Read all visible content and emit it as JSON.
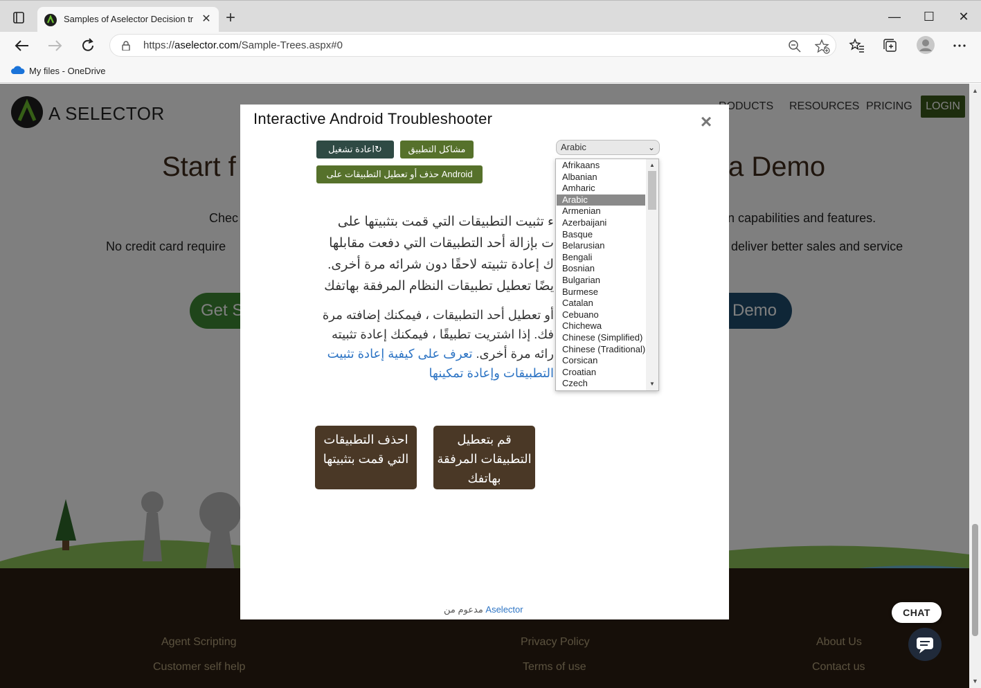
{
  "browser": {
    "tab_title": "Samples of Aselector Decision tr",
    "tab_close": "✕",
    "new_tab": "+",
    "url_prefix": "https://",
    "url_host": "aselector.com",
    "url_path": "/Sample-Trees.aspx#0",
    "favorites_bar": [
      {
        "label": "My files - OneDrive"
      }
    ],
    "window_controls": [
      "—",
      "☐",
      "✕"
    ]
  },
  "site": {
    "logo_text": "A SELECTOR",
    "nav": [
      "RODUCTS",
      "RESOURCES",
      "PRICING"
    ],
    "login_label": "LOGIN",
    "hero_left": "Start f",
    "hero_right": "a Demo",
    "sub1_left": "Chec",
    "sub1_right": "n capabilities and features.",
    "sub2_left": "No credit card require",
    "sub2_right": "deliver better sales and service",
    "cta_left": "Get S",
    "cta_right": "Demo",
    "footer": {
      "col1": [
        "Agent Scripting",
        "Customer self help"
      ],
      "col2": [
        "Privacy Policy",
        "Terms of use"
      ],
      "col3": [
        "About Us",
        "Contact us"
      ]
    },
    "chat_label": "CHAT"
  },
  "modal": {
    "title": "Interactive Android Troubleshooter",
    "close": "×",
    "restart_label": "اعادة تشغيل↻",
    "crumb1_label": "مشاكل التطبيق",
    "crumb2_label": "حذف أو تعطيل التطبيقات على Android",
    "language_selected": "Arabic",
    "languages": [
      "Afrikaans",
      "Albanian",
      "Amharic",
      "Arabic",
      "Armenian",
      "Azerbaijani",
      "Basque",
      "Belarusian",
      "Bengali",
      "Bosnian",
      "Bulgarian",
      "Burmese",
      "Catalan",
      "Cebuano",
      "Chichewa",
      "Chinese (Simplified)",
      "Chinese (Traditional)",
      "Corsican",
      "Croatian",
      "Czech"
    ],
    "para1_lines": [
      "ء تثبيت التطبيقات التي قمت بتثبيتها على",
      "ت بإزالة أحد التطبيقات التي دفعت مقابلها",
      "ك إعادة تثبيته لاحقًا دون شرائه مرة أخرى.",
      "يضًا تعطيل تطبيقات النظام المرفقة بهاتفك"
    ],
    "para2_line1": "أو تعطيل أحد التطبيقات ، فيمكنك إضافته مرة",
    "para2_line2": "فك. إذا اشتريت تطبيقًا ، فيمكنك إعادة تثبيته",
    "para2_line3_text": "رائه مرة أخرى. ",
    "para2_line3_link": "تعرف على كيفية إعادة تثبيت",
    "para2_line4_link": "التطبيقات وإعادة تمكينها",
    "btn_delete": "احذف التطبيقات التي قمت بتثبيتها",
    "btn_disable": "قم بتعطيل التطبيقات المرفقة بهاتفك",
    "powered_link": "Aselector",
    "powered_text": " مدعوم من"
  },
  "colors": {
    "accent_green": "#56712b",
    "restart_teal": "#2f4a44",
    "option_button_brown": "#4a3826",
    "footer_bg": "#2d1e12",
    "link_blue": "#2d74c4"
  }
}
